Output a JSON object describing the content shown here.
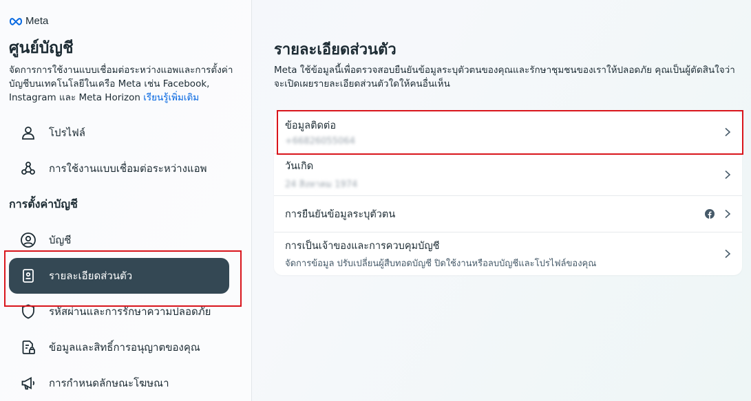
{
  "brand": {
    "name": "Meta"
  },
  "sidebar": {
    "title": "ศูนย์บัญชี",
    "description": "จัดการการใช้งานแบบเชื่อมต่อระหว่างแอพและการตั้งค่าบัญชีบนเทคโนโลยีในเครือ Meta เช่น Facebook, Instagram และ Meta Horizon",
    "learn_more": "เรียนรู้เพิ่มเติม",
    "items_top": [
      {
        "label": "โปรไฟล์",
        "icon": "person-icon"
      },
      {
        "label": "การใช้งานแบบเชื่อมต่อระหว่างแอพ",
        "icon": "connected-nodes-icon"
      }
    ],
    "section_heading": "การตั้งค่าบัญชี",
    "items_settings": [
      {
        "label": "บัญชี",
        "icon": "account-circle-icon"
      },
      {
        "label": "รายละเอียดส่วนตัว",
        "icon": "id-card-icon",
        "active": true
      },
      {
        "label": "รหัสผ่านและการรักษาความปลอดภัย",
        "icon": "shield-icon"
      },
      {
        "label": "ข้อมูลและสิทธิ์การอนุญาตของคุณ",
        "icon": "document-lock-icon"
      },
      {
        "label": "การกำหนดลักษณะโฆษณา",
        "icon": "megaphone-icon"
      }
    ]
  },
  "main": {
    "title": "รายละเอียดส่วนตัว",
    "description": "Meta ใช้ข้อมูลนี้เพื่อตรวจสอบยืนยันข้อมูลระบุตัวตนของคุณและรักษาชุมชนของเราให้ปลอดภัย คุณเป็นผู้ตัดสินใจว่าจะเปิดเผยรายละเอียดส่วนตัวใดให้คนอื่นเห็น",
    "rows": [
      {
        "label": "ข้อมูลติดต่อ",
        "value": "+66826055064"
      },
      {
        "label": "วันเกิด",
        "value": "24 สิงหาคม 1974"
      },
      {
        "label": "การยืนยันข้อมูลระบุตัวตน",
        "icon": "facebook-icon"
      },
      {
        "label": "การเป็นเจ้าของและการควบคุมบัญชี",
        "sub": "จัดการข้อมูล ปรับเปลี่ยนผู้สืบทอดบัญชี ปิดใช้งานหรือลบบัญชีและโปรไฟล์ของคุณ"
      }
    ]
  },
  "colors": {
    "active_bg": "#344854",
    "link": "#0064e0",
    "highlight": "#d9141b"
  }
}
